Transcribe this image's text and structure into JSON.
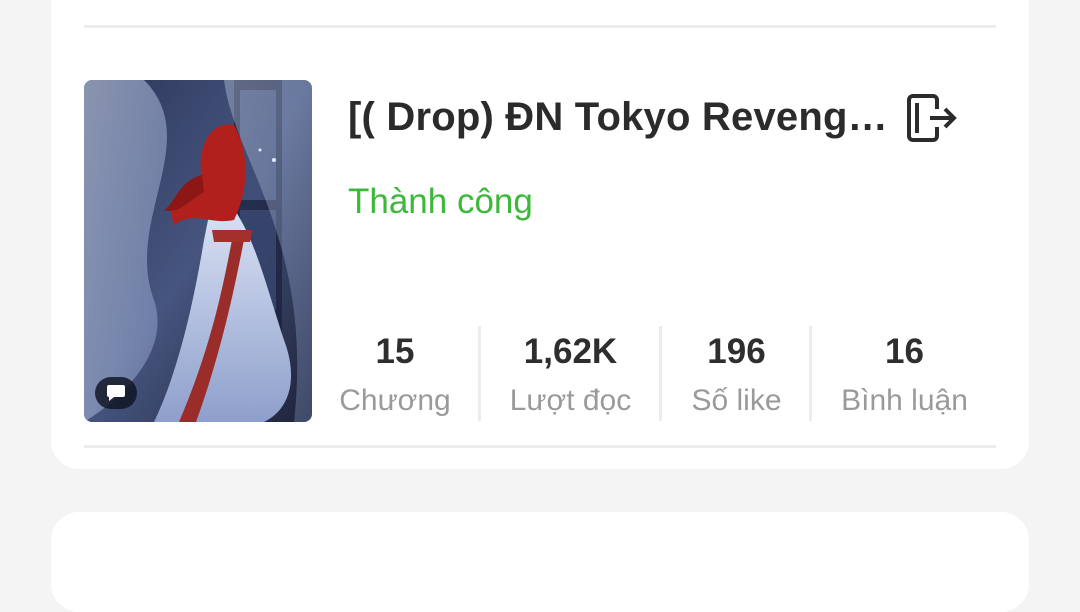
{
  "story": {
    "title": "[( Drop) ĐN Tokyo Revenge…",
    "status": "Thành công",
    "status_color": "#3cb83a",
    "exit_icon": "exit-icon",
    "comment_icon": "comment-icon"
  },
  "stats": [
    {
      "value": "15",
      "label": "Chương"
    },
    {
      "value": "1,62K",
      "label": "Lượt đọc"
    },
    {
      "value": "196",
      "label": "Số like"
    },
    {
      "value": "16",
      "label": "Bình luận"
    }
  ]
}
